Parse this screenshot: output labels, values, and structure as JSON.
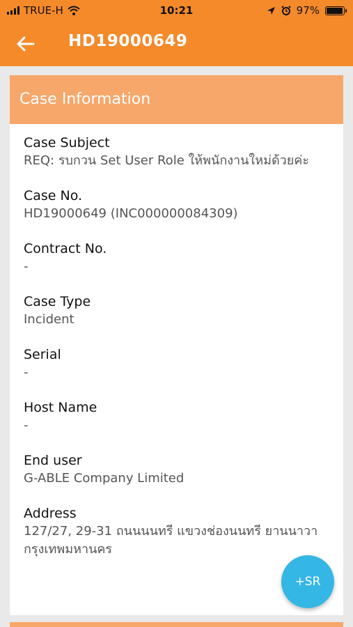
{
  "status_bar": {
    "carrier": "TRUE-H",
    "time": "10:21",
    "battery": "97%",
    "battery_level": 0.97,
    "icons": [
      "signal-icon",
      "wifi-icon",
      "location-icon",
      "alarm-icon",
      "battery-icon"
    ]
  },
  "header": {
    "title": "HD19000649",
    "back_icon": "back-arrow-icon"
  },
  "section": {
    "title": "Case Information"
  },
  "fields": [
    {
      "label": "Case Subject",
      "value": "REQ: รบกวน Set User Role ให้พนักงานใหม่ด้วยค่ะ"
    },
    {
      "label": "Case No.",
      "value": "HD19000649 (INC000000084309)"
    },
    {
      "label": "Contract No.",
      "value": "-"
    },
    {
      "label": "Case Type",
      "value": "Incident"
    },
    {
      "label": "Serial",
      "value": "-"
    },
    {
      "label": "Host Name",
      "value": "-"
    },
    {
      "label": "End user",
      "value": "G-ABLE Company Limited"
    },
    {
      "label": "Address",
      "value": "127/27, 29-31 ถนนนนทรี แขวงช่องนนทรี ยานนาวา กรุงเทพมหานคร"
    }
  ],
  "fab": {
    "label": "+SR"
  },
  "colors": {
    "primary": "#f58a2a",
    "section_header": "#f7a76a",
    "fab": "#35b7e6"
  }
}
